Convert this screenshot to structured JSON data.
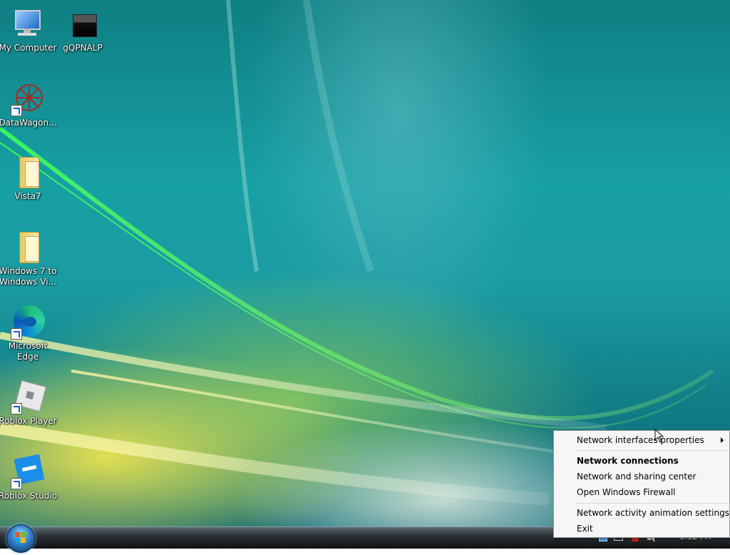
{
  "desktop": {
    "icons": [
      {
        "label": "My Computer",
        "icon": "computer-icon",
        "shortcut": false
      },
      {
        "label": "gQPNALP",
        "icon": "window-icon",
        "shortcut": false
      },
      {
        "label": "DataWagon...",
        "icon": "datawagon-icon",
        "shortcut": true
      },
      {
        "label": "Vista7",
        "icon": "folder-icon",
        "shortcut": false
      },
      {
        "label": "Windows 7 to Windows Vi...",
        "icon": "folder-icon",
        "shortcut": false
      },
      {
        "label": "Microsoft Edge",
        "icon": "edge-icon",
        "shortcut": true
      },
      {
        "label": "Roblox Player",
        "icon": "roblox-player-icon",
        "shortcut": true
      },
      {
        "label": "Roblox Studio",
        "icon": "roblox-studio-icon",
        "shortcut": true
      }
    ]
  },
  "context_menu": {
    "items": [
      {
        "label": "Network interfaces properties",
        "bold": false,
        "submenu": true
      },
      {
        "label": "Network connections",
        "bold": true,
        "submenu": false
      },
      {
        "label": "Network and sharing center",
        "bold": false,
        "submenu": false
      },
      {
        "label": "Open Windows Firewall",
        "bold": false,
        "submenu": false
      },
      {
        "label": "Network activity animation settings",
        "bold": false,
        "submenu": false
      },
      {
        "label": "Exit",
        "bold": false,
        "submenu": false
      }
    ]
  },
  "taskbar": {
    "clock": "5:52 PM",
    "tray_icons": [
      "network-icon",
      "monitor-icon",
      "firewall-alert-icon",
      "volume-icon"
    ]
  },
  "colors": {
    "menu_bg": "#f6f6f6",
    "taskbar": "#1c2226",
    "accent": "#2f7fc4"
  }
}
